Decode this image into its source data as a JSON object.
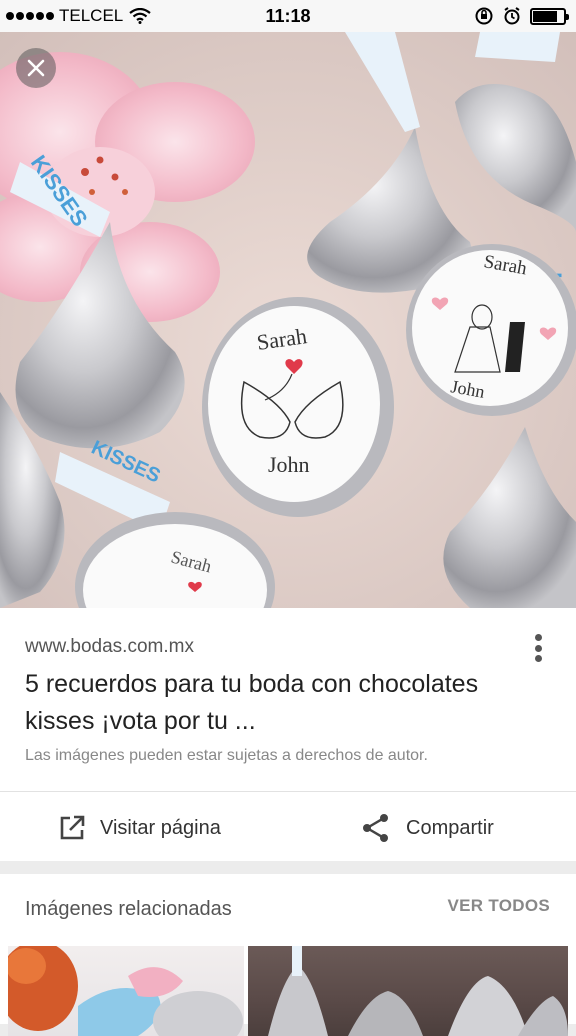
{
  "status_bar": {
    "carrier": "TELCEL",
    "time": "11:18",
    "icons": [
      "signal-dots-icon",
      "wifi-icon",
      "orientation-lock-icon",
      "alarm-icon",
      "battery-icon"
    ],
    "battery_level": 0.8
  },
  "hero_image": {
    "label_name_top": "Sarah",
    "label_name_bottom": "John",
    "wrapper_text": "KISSES"
  },
  "result": {
    "source_url": "www.bodas.com.mx",
    "title": "5 recuerdos para tu boda con chocolates kisses ¡vota por tu ...",
    "copyright_note": "Las imágenes pueden estar sujetas a derechos de autor.",
    "visit_label": "Visitar página",
    "share_label": "Compartir"
  },
  "related": {
    "title": "Imágenes relacionadas",
    "view_all_label": "VER TODOS"
  },
  "colors": {
    "accent_heart": "#e03a4a",
    "ribbon_blue": "#4a9fd8",
    "foil_silver": "#c8c8cc"
  }
}
